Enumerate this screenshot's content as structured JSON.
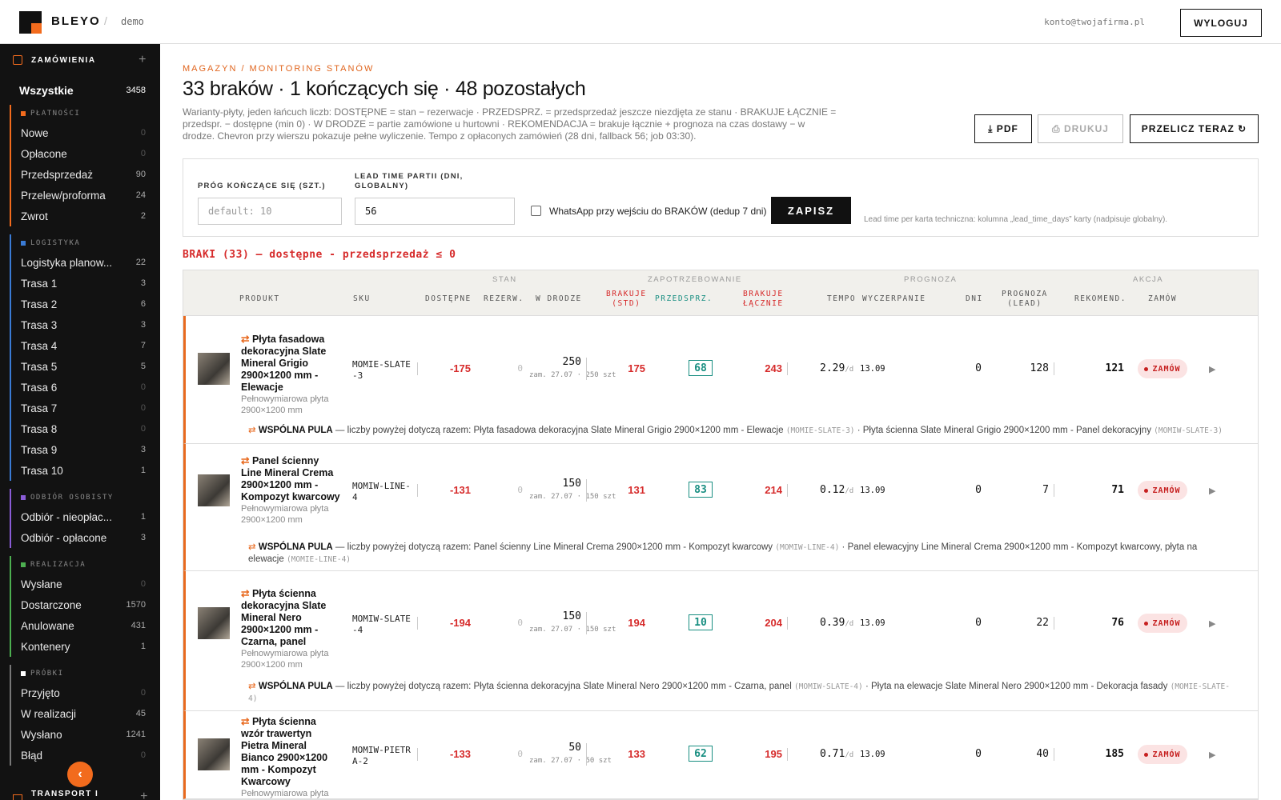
{
  "header": {
    "brand": "BLEYO",
    "sep": "/",
    "crumb": "demo",
    "account": "konto@twojafirma.pl",
    "logout": "WYLOGUJ"
  },
  "sidebar": {
    "section": "ZAMÓWIENIA",
    "all": {
      "label": "Wszystkie",
      "count": "3458"
    },
    "groups": [
      {
        "title": "PŁATNOŚCI",
        "color": "#f26b1d",
        "items": [
          {
            "label": "Nowe",
            "count": "0"
          },
          {
            "label": "Opłacone",
            "count": "0"
          },
          {
            "label": "Przedsprzedaż",
            "count": "90"
          },
          {
            "label": "Przelew/proforma",
            "count": "24"
          },
          {
            "label": "Zwrot",
            "count": "2"
          }
        ]
      },
      {
        "title": "LOGISTYKA",
        "color": "#3a7bd5",
        "items": [
          {
            "label": "Logistyka planow...",
            "count": "22"
          },
          {
            "label": "Trasa 1",
            "count": "3"
          },
          {
            "label": "Trasa 2",
            "count": "6"
          },
          {
            "label": "Trasa 3",
            "count": "3"
          },
          {
            "label": "Trasa 4",
            "count": "7"
          },
          {
            "label": "Trasa 5",
            "count": "5"
          },
          {
            "label": "Trasa 6",
            "count": "0"
          },
          {
            "label": "Trasa 7",
            "count": "0"
          },
          {
            "label": "Trasa 8",
            "count": "0"
          },
          {
            "label": "Trasa 9",
            "count": "3"
          },
          {
            "label": "Trasa 10",
            "count": "1"
          }
        ]
      },
      {
        "title": "ODBIÓR OSOBISTY",
        "color": "#8a5cd6",
        "items": [
          {
            "label": "Odbiór - nieopłac...",
            "count": "1"
          },
          {
            "label": "Odbiór - opłacone",
            "count": "3"
          }
        ]
      },
      {
        "title": "REALIZACJA",
        "color": "#4caf50",
        "items": [
          {
            "label": "Wysłane",
            "count": "0"
          },
          {
            "label": "Dostarczone",
            "count": "1570"
          },
          {
            "label": "Anulowane",
            "count": "431"
          },
          {
            "label": "Kontenery",
            "count": "1"
          }
        ]
      },
      {
        "title": "PRÓBKI",
        "color": "#ffffff",
        "items": [
          {
            "label": "Przyjęto",
            "count": "0"
          },
          {
            "label": "W realizacji",
            "count": "45"
          },
          {
            "label": "Wysłano",
            "count": "1241"
          },
          {
            "label": "Błąd",
            "count": "0"
          }
        ]
      }
    ],
    "footer": "TRANSPORT I"
  },
  "page": {
    "eyebrow": "MAGAZYN / MONITORING STANÓW",
    "title": "33 braków · 1 kończących się · 48 pozostałych",
    "desc": "Warianty-płyty, jeden łańcuch liczb: DOSTĘPNE = stan − rezerwacje · PRZEDSPRZ. = przedsprzedaż jeszcze niezdjęta ze stanu · BRAKUJE ŁĄCZNIE = przedspr. − dostępne (min 0) · W DRODZE = partie zamówione u hurtowni · REKOMENDACJA = brakuje łącznie + prognoza na czas dostawy − w drodze. Chevron przy wierszu pokazuje pełne wyliczenie. Tempo z opłaconych zamówień (28 dni, fallback 56; job 03:30).",
    "btn_pdf": "⤓ PDF",
    "btn_print": "⎙ DRUKUJ",
    "btn_recalc": "PRZELICZ TERAZ ↻"
  },
  "settings": {
    "threshold_label": "PRÓG KOŃCZĄCE SIĘ (SZT.)",
    "threshold_placeholder": "default: 10",
    "lead_label": "LEAD TIME PARTII (DNI, GLOBALNY)",
    "lead_value": "56",
    "whatsapp": "WhatsApp przy wejściu do BRAKÓW (dedup 7 dni)",
    "save": "ZAPISZ",
    "hint": "Lead time per karta techniczna: kolumna „lead_time_days” karty (nadpisuje globalny)."
  },
  "section_title": "BRAKI (33) — dostępne - przedsprzedaż ≤ 0",
  "table": {
    "groups": [
      "STAN",
      "ZAPOTRZEBOWANIE",
      "PROGNOZA",
      "AKCJA"
    ],
    "cols": {
      "product": "PRODUKT",
      "sku": "SKU",
      "avail": "DOSTĘPNE",
      "res": "REZERW.",
      "transit": "W DRODZE",
      "short1": "BRAKUJE",
      "short2": "(STD)",
      "pre": "PRZEDSPRZ.",
      "tot1": "BRAKUJE",
      "tot2": "ŁĄCZNIE",
      "tempo": "TEMPO",
      "exh": "WYCZERPANIE",
      "days": "DNI",
      "fc1": "PROGNOZA",
      "fc2": "(LEAD)",
      "rec": "REKOMEND.",
      "order": "ZAMÓW"
    },
    "rows": [
      {
        "name": "Płyta fasadowa dekoracyjna Slate Mineral Grigio 2900×1200 mm - Elewacje",
        "sub": "Pełnowymiarowa płyta 2900×1200 mm",
        "sku": "MOMIE-SLATE-3",
        "avail": "-175",
        "res": "0",
        "transit": "250",
        "transit_note": "zam. 27.07 · 250 szt",
        "short": "175",
        "pre": "68",
        "total": "243",
        "tempo": "2.29",
        "tempo_unit": "/d",
        "exh": "13.09",
        "days": "0",
        "forecast": "128",
        "rec": "121",
        "order": "ZAMÓW",
        "pool_label": "WSPÓLNA PULA",
        "pool_text": "— liczby powyżej dotyczą razem: Płyta fasadowa dekoracyjna Slate Mineral Grigio 2900×1200 mm - Elewacje",
        "pool_code1": "(MOMIE-SLATE-3)",
        "pool_text2": "· Płyta ścienna Slate Mineral Grigio 2900×1200 mm - Panel dekoracyjny",
        "pool_code2": "(MOMIW-SLATE-3)"
      },
      {
        "name": "Panel ścienny Line Mineral Crema 2900×1200 mm - Kompozyt kwarcowy",
        "sub": "Pełnowymiarowa płyta 2900×1200 mm",
        "sku": "MOMIW-LINE-4",
        "avail": "-131",
        "res": "0",
        "transit": "150",
        "transit_note": "zam. 27.07 · 150 szt",
        "short": "131",
        "pre": "83",
        "total": "214",
        "tempo": "0.12",
        "tempo_unit": "/d",
        "exh": "13.09",
        "days": "0",
        "forecast": "7",
        "rec": "71",
        "order": "ZAMÓW",
        "pool_label": "WSPÓLNA PULA",
        "pool_text": "— liczby powyżej dotyczą razem: Panel ścienny Line Mineral Crema 2900×1200 mm - Kompozyt kwarcowy",
        "pool_code1": "(MOMIW-LINE-4)",
        "pool_text2": "· Panel elewacyjny Line Mineral Crema 2900×1200 mm - Kompozyt kwarcowy, płyta na elewacje",
        "pool_code2": "(MOMIE-LINE-4)"
      },
      {
        "name": "Płyta ścienna dekoracyjna Slate Mineral Nero 2900×1200 mm - Czarna, panel",
        "sub": "Pełnowymiarowa płyta 2900×1200 mm",
        "sku": "MOMIW-SLATE-4",
        "avail": "-194",
        "res": "0",
        "transit": "150",
        "transit_note": "zam. 27.07 · 150 szt",
        "short": "194",
        "pre": "10",
        "total": "204",
        "tempo": "0.39",
        "tempo_unit": "/d",
        "exh": "13.09",
        "days": "0",
        "forecast": "22",
        "rec": "76",
        "order": "ZAMÓW",
        "pool_label": "WSPÓLNA PULA",
        "pool_text": "— liczby powyżej dotyczą razem: Płyta ścienna dekoracyjna Slate Mineral Nero 2900×1200 mm - Czarna, panel",
        "pool_code1": "(MOMIW-SLATE-4)",
        "pool_text2": "· Płyta na elewacje Slate Mineral Nero 2900×1200 mm - Dekoracja fasady",
        "pool_code2": "(MOMIE-SLATE-4)"
      },
      {
        "name": "Płyta ścienna wzór trawertyn Pietra Mineral Bianco 2900×1200 mm - Kompozyt Kwarcowy",
        "sub": "Pełnowymiarowa płyta",
        "sku": "MOMIW-PIETRA-2",
        "avail": "-133",
        "res": "0",
        "transit": "50",
        "transit_note": "zam. 27.07 · 50 szt",
        "short": "133",
        "pre": "62",
        "total": "195",
        "tempo": "0.71",
        "tempo_unit": "/d",
        "exh": "13.09",
        "days": "0",
        "forecast": "40",
        "rec": "185",
        "order": "ZAMÓW"
      }
    ]
  },
  "colors": {
    "accent": "#f26b1d",
    "danger": "#d62b2b",
    "teal": "#1a8f82"
  }
}
